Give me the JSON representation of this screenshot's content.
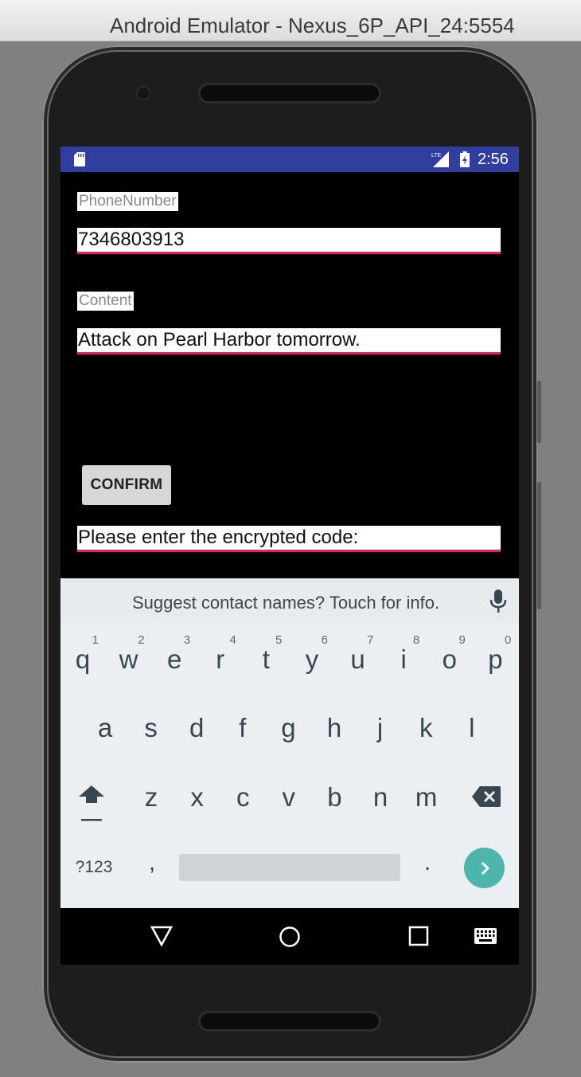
{
  "window": {
    "title": "Android Emulator - Nexus_6P_API_24:5554"
  },
  "statusbar": {
    "time": "2:56",
    "network_label": "LTE",
    "color": "#303f9f"
  },
  "form": {
    "phone_label": "PhoneNumber",
    "phone_value": "7346803913",
    "content_label": "Content",
    "content_value": "Attack on Pearl Harbor tomorrow.",
    "confirm_label": "CONFIRM",
    "code_value": "Please enter the encrypted code:",
    "accent_color": "#e91e63"
  },
  "keyboard": {
    "suggestion": "Suggest contact names? Touch for info.",
    "row1": [
      {
        "key": "q",
        "hint": "1"
      },
      {
        "key": "w",
        "hint": "2"
      },
      {
        "key": "e",
        "hint": "3"
      },
      {
        "key": "r",
        "hint": "4"
      },
      {
        "key": "t",
        "hint": "5"
      },
      {
        "key": "y",
        "hint": "6"
      },
      {
        "key": "u",
        "hint": "7"
      },
      {
        "key": "i",
        "hint": "8"
      },
      {
        "key": "o",
        "hint": "9"
      },
      {
        "key": "p",
        "hint": "0"
      }
    ],
    "row2": [
      "a",
      "s",
      "d",
      "f",
      "g",
      "h",
      "j",
      "k",
      "l"
    ],
    "row3": [
      "z",
      "x",
      "c",
      "v",
      "b",
      "n",
      "m"
    ],
    "symbols_label": "?123",
    "comma": ",",
    "period": ".",
    "enter_color": "#4cb6ac"
  },
  "icons": [
    "sd-card-icon",
    "lte-signal-icon",
    "battery-charging-icon",
    "mic-icon",
    "shift-icon",
    "backspace-icon",
    "enter-arrow-icon",
    "back-icon",
    "home-icon",
    "recents-icon",
    "keyboard-icon"
  ]
}
